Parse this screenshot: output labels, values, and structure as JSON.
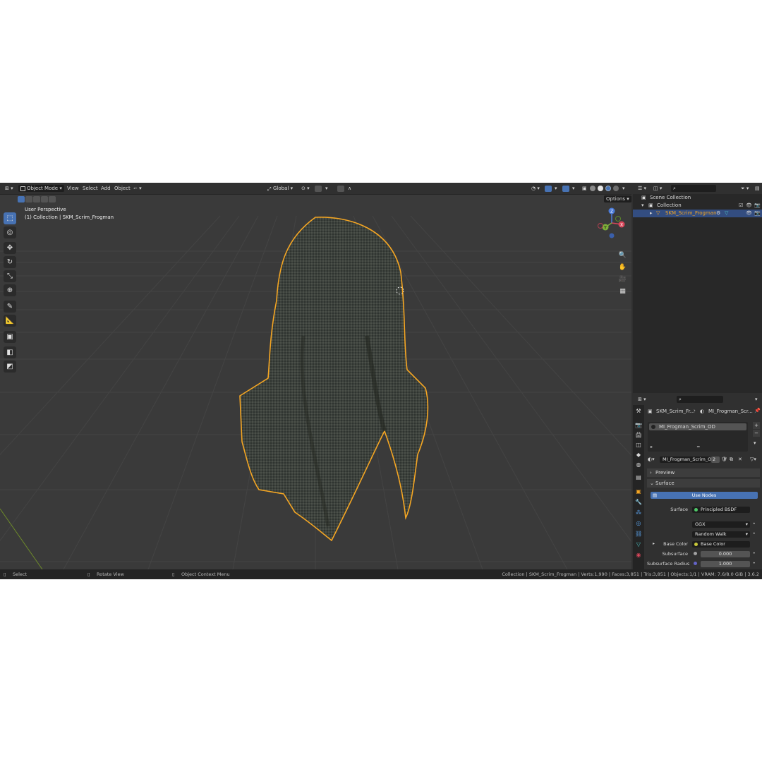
{
  "header": {
    "mode": "Object Mode",
    "menus": [
      "View",
      "Select",
      "Add",
      "Object"
    ],
    "orientation": "Global"
  },
  "viewport": {
    "title": "User Perspective",
    "subtitle": "(1) Collection | SKM_Scrim_Frogman",
    "options_label": "Options",
    "gizmo_axes": [
      "Z",
      "Y",
      "X"
    ]
  },
  "outliner": {
    "items": [
      {
        "label": "Scene Collection"
      },
      {
        "label": "Collection"
      },
      {
        "label": "SKM_Scrim_Frogman"
      }
    ]
  },
  "properties": {
    "breadcrumb_object": "SKM_Scrim_Fr...",
    "breadcrumb_material": "MI_Frogman_Scr...",
    "material_slot": "MI_Frogman_Scrim_OD",
    "material_name": "MI_Frogman_Scrim_OD",
    "user_count": "2",
    "preview_label": "Preview",
    "surface_panel_label": "Surface",
    "use_nodes_label": "Use Nodes",
    "surface_label": "Surface",
    "surface_value": "Principled BSDF",
    "distribution": "GGX",
    "subsurface_method": "Random Walk",
    "base_color_label": "Base Color",
    "base_color_value": "Base Color",
    "subsurface_label": "Subsurface",
    "subsurface_value": "0.000",
    "subsurface_radius_label": "Subsurface Radius",
    "subsurface_radius_value": "1.000"
  },
  "status": {
    "select": "Select",
    "rotate": "Rotate View",
    "context": "Object Context Menu",
    "stats": "Collection | SKM_Scrim_Frogman | Verts:1,990 | Faces:3,851 | Tris:3,851 | Objects:1/1 | VRAM: 7.6/8.0 GiB | 3.6.2"
  },
  "colors": {
    "accent": "#4772b3",
    "selection_outline": "#f5a623",
    "viewport_bg": "#3a3a3a"
  }
}
